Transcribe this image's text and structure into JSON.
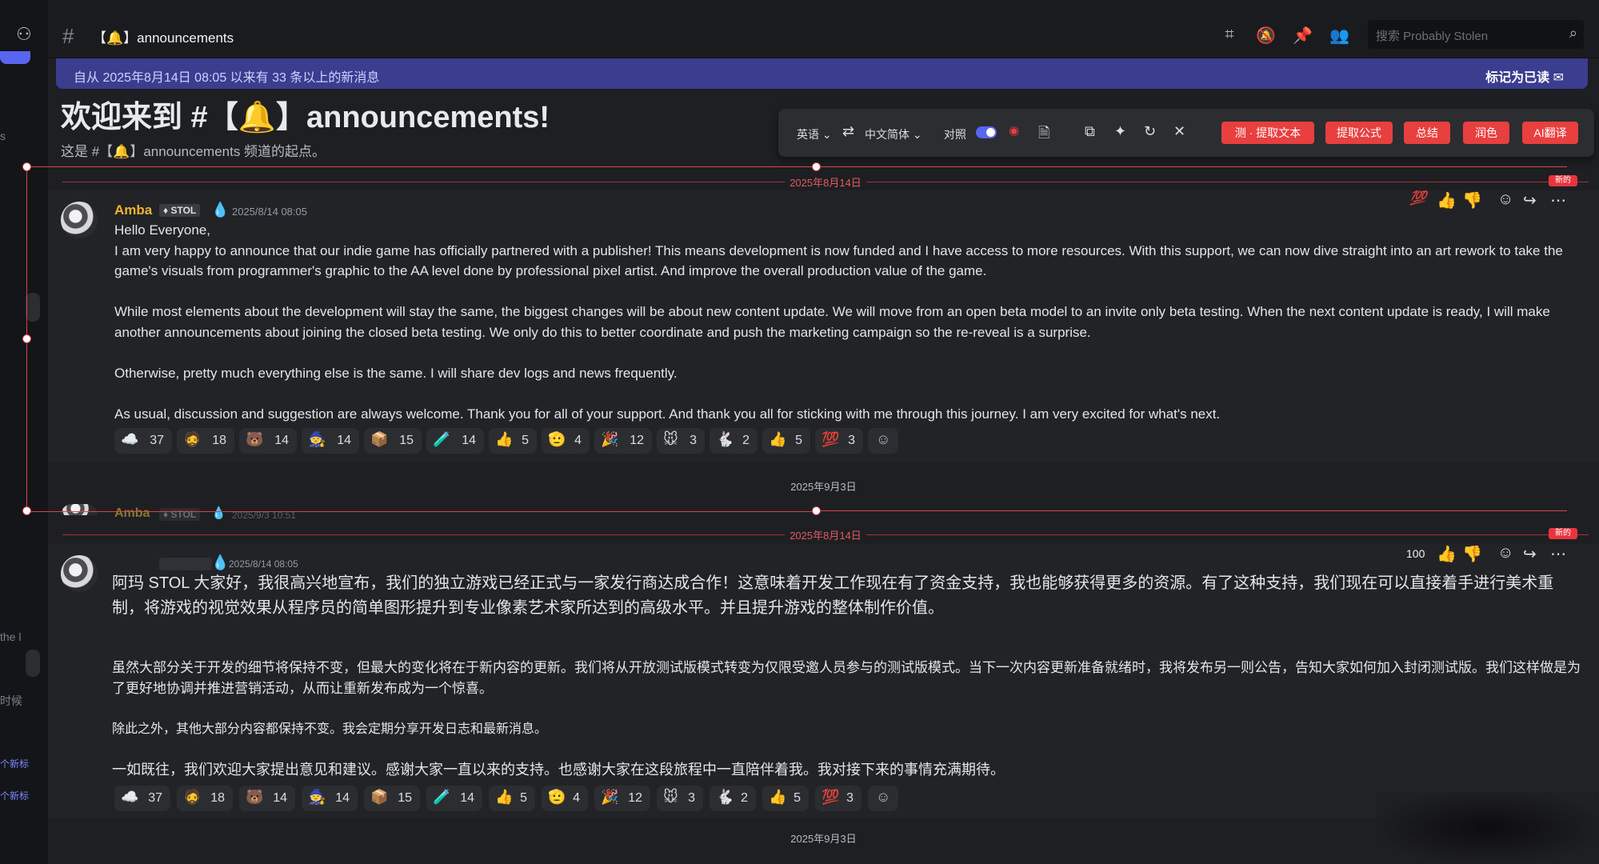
{
  "left_rail": {
    "fragments": [
      "s",
      "the l",
      "时候",
      "个新标",
      "个新标"
    ]
  },
  "topbar": {
    "channel_name": "【🔔】announcements",
    "search_placeholder": "搜索 Probably Stolen"
  },
  "new_messages_bar": {
    "text": "自从 2025年8月14日 08:05 以来有 33 条以上的新消息",
    "mark_read": "标记为已读"
  },
  "welcome": {
    "title": "欢迎来到 #【🔔】announcements!",
    "subtitle": "这是 #【🔔】announcements 频道的起点。"
  },
  "translate_toolbar": {
    "source_lang": "英语",
    "target_lang": "中文简体",
    "compare_label": "对照",
    "buttons": [
      "测 · 提取文本",
      "提取公式",
      "总结",
      "润色",
      "AI翻译"
    ]
  },
  "dividers": {
    "first_date": "2025年8月14日",
    "second_date": "2025年9月3日",
    "third_date": "2025年8月14日",
    "fourth_date": "2025年9月3日",
    "new_tag": "新的"
  },
  "message_en": {
    "username": "Amba",
    "tag": "STOL",
    "timestamp": "2025/8/14 08:05",
    "greeting": "Hello Everyone,",
    "paragraphs": [
      "I am very happy to announce that our indie game has officially partnered with a publisher! This means development is now funded and I have access to more resources. With this support, we can now dive straight into an art rework to take the game's visuals from programmer's graphic to the AA level done by professional pixel artist. And improve the overall production value of the game.",
      "While most elements about the development will stay the same, the biggest changes will be about new content update. We will move from an open beta model to an invite only beta testing.  When the next content update is ready, I will make another announcements about joining the closed beta testing. We only do this to better coordinate and push the marketing campaign so the re-reveal is a surprise.",
      "Otherwise, pretty much everything else is the same. I will share dev logs and news frequently.",
      "As usual, discussion and suggestion are always welcome. Thank you for all of your support. And thank you all for sticking with me through this journey. I am very excited for what's next."
    ]
  },
  "ghost_message": {
    "username": "Amba",
    "tag": "STOL",
    "timestamp": "2025/9/3 10:51"
  },
  "message_cn": {
    "timestamp": "2025/8/14 08:05",
    "paragraphs": [
      "阿玛 STOL 大家好，我很高兴地宣布，我们的独立游戏已经正式与一家发行商达成合作！这意味着开发工作现在有了资金支持，我也能够获得更多的资源。有了这种支持，我们现在可以直接着手进行美术重制，将游戏的视觉效果从程序员的简单图形提升到专业像素艺术家所达到的高级水平。并且提升游戏的整体制作价值。",
      "虽然大部分关于开发的细节将保持不变，但最大的变化将在于新内容的更新。我们将从开放测试版模式转变为仅限受邀人员参与的测试版模式。当下一次内容更新准备就绪时，我将发布另一则公告，告知大家如何加入封闭测试版。我们这样做是为了更好地协调并推进营销活动，从而让重新发布成为一个惊喜。",
      "除此之外，其他大部分内容都保持不变。我会定期分享开发日志和最新消息。",
      "一如既往，我们欢迎大家提出意见和建议。感谢大家一直以来的支持。也感谢大家在这段旅程中一直陪伴着我。我对接下来的事情充满期待。"
    ]
  },
  "reactions": [
    {
      "emoji": "☁️",
      "count": "37"
    },
    {
      "emoji": "🧔",
      "count": "18"
    },
    {
      "emoji": "🐻",
      "count": "14"
    },
    {
      "emoji": "🧙",
      "count": "14"
    },
    {
      "emoji": "📦",
      "count": "15"
    },
    {
      "emoji": "🧪",
      "count": "14"
    },
    {
      "emoji": "👍",
      "count": "5"
    },
    {
      "emoji": "🫡",
      "count": "4"
    },
    {
      "emoji": "🎉",
      "count": "12"
    },
    {
      "emoji": "🐭",
      "count": "3"
    },
    {
      "emoji": "🐇",
      "count": "2"
    },
    {
      "emoji": "👍",
      "count": "5"
    },
    {
      "emoji": "💯",
      "count": "3"
    }
  ],
  "hover_actions": {
    "hundred_label": "100"
  }
}
